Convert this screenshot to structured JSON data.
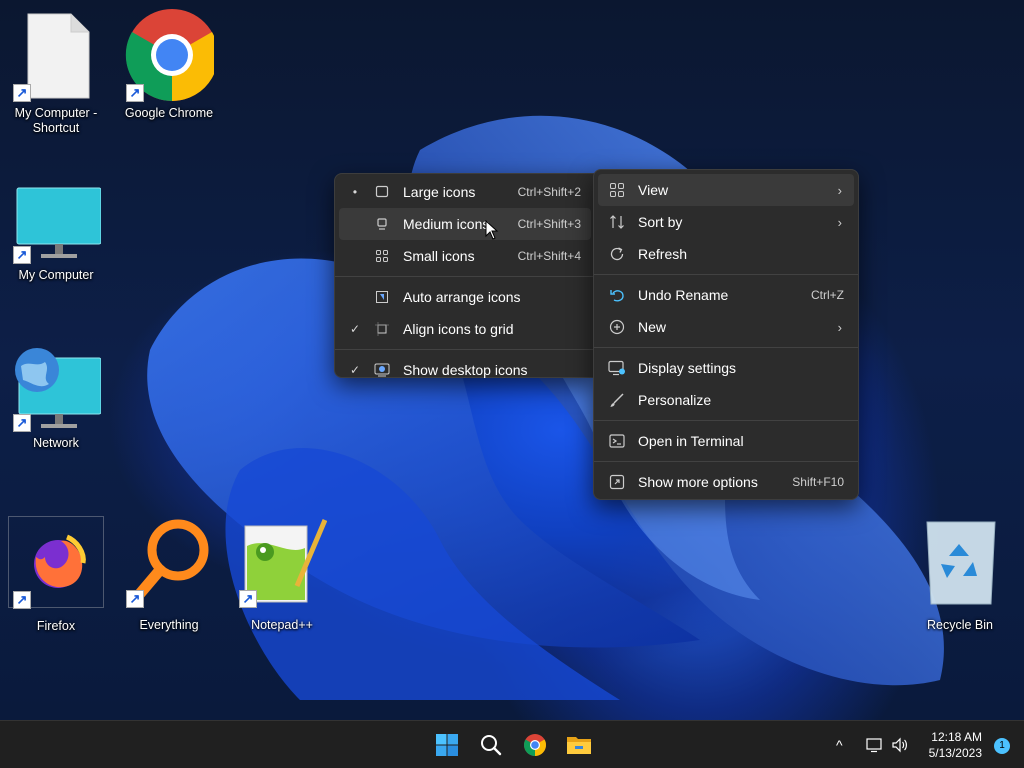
{
  "desktop": {
    "icons": [
      {
        "label": "My Computer - Shortcut"
      },
      {
        "label": "Google Chrome"
      },
      {
        "label": "My Computer"
      },
      {
        "label": "Network"
      },
      {
        "label": "Firefox"
      },
      {
        "label": "Everything"
      },
      {
        "label": "Notepad++"
      },
      {
        "label": "Recycle Bin"
      }
    ]
  },
  "submenu": {
    "items": [
      {
        "label": "Large icons",
        "shortcut": "Ctrl+Shift+2",
        "icon": "large-icons-icon",
        "mark": "•"
      },
      {
        "label": "Medium icons",
        "shortcut": "Ctrl+Shift+3",
        "icon": "medium-icons-icon",
        "mark": ""
      },
      {
        "label": "Small icons",
        "shortcut": "Ctrl+Shift+4",
        "icon": "small-icons-icon",
        "mark": ""
      },
      {
        "label": "Auto arrange icons",
        "shortcut": "",
        "icon": "auto-arrange-icon",
        "mark": ""
      },
      {
        "label": "Align icons to grid",
        "shortcut": "",
        "icon": "align-grid-icon",
        "mark": "✓"
      },
      {
        "label": "Show desktop icons",
        "shortcut": "",
        "icon": "show-desktop-icon",
        "mark": "✓"
      }
    ]
  },
  "context_menu": {
    "items": [
      {
        "label": "View",
        "shortcut": "",
        "icon": "view-grid-icon",
        "arrow": "›"
      },
      {
        "label": "Sort by",
        "shortcut": "",
        "icon": "sort-icon",
        "arrow": "›"
      },
      {
        "label": "Refresh",
        "shortcut": "",
        "icon": "refresh-icon",
        "arrow": ""
      },
      {
        "label": "Undo Rename",
        "shortcut": "Ctrl+Z",
        "icon": "undo-icon",
        "arrow": ""
      },
      {
        "label": "New",
        "shortcut": "",
        "icon": "new-plus-icon",
        "arrow": "›"
      },
      {
        "label": "Display settings",
        "shortcut": "",
        "icon": "display-settings-icon",
        "arrow": ""
      },
      {
        "label": "Personalize",
        "shortcut": "",
        "icon": "personalize-brush-icon",
        "arrow": ""
      },
      {
        "label": "Open in Terminal",
        "shortcut": "",
        "icon": "terminal-icon",
        "arrow": ""
      },
      {
        "label": "Show more options",
        "shortcut": "Shift+F10",
        "icon": "more-options-icon",
        "arrow": ""
      }
    ]
  },
  "taskbar": {
    "time": "12:18 AM",
    "date": "5/13/2023",
    "notification_count": "1",
    "tray_chevron": "^"
  }
}
